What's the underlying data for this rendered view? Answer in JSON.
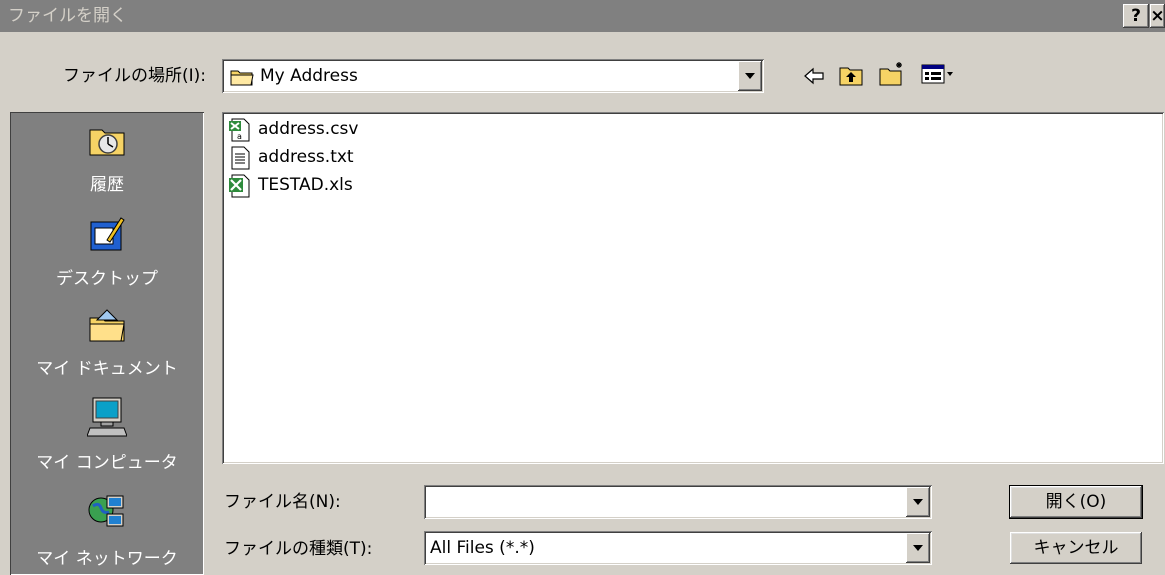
{
  "window": {
    "title": "ファイルを開く",
    "help_button": "?",
    "close_button": "×"
  },
  "location": {
    "label": "ファイルの場所(I):",
    "value": "My Address"
  },
  "places": [
    {
      "label": "履歴",
      "icon": "history-folder-icon"
    },
    {
      "label": "デスクトップ",
      "icon": "desktop-icon"
    },
    {
      "label": "マイ ドキュメント",
      "icon": "my-documents-folder-icon"
    },
    {
      "label": "マイ コンピュータ",
      "icon": "my-computer-icon"
    },
    {
      "label": "マイ ネットワーク",
      "icon": "my-network-icon"
    }
  ],
  "files": [
    {
      "name": "address.csv",
      "icon": "excel-csv-icon"
    },
    {
      "name": "address.txt",
      "icon": "text-file-icon"
    },
    {
      "name": "TESTAD.xls",
      "icon": "excel-file-icon"
    }
  ],
  "filename": {
    "label": "ファイル名(N):",
    "value": ""
  },
  "filetype": {
    "label": "ファイルの種類(T):",
    "value": "All Files (*.*)"
  },
  "buttons": {
    "open": "開く(O)",
    "cancel": "キャンセル"
  },
  "colors": {
    "dialog_face": "#d4d0c8",
    "titlebar_inactive": "#808080",
    "places_bar": "#808080",
    "excel_green": "#2e8b3c"
  }
}
